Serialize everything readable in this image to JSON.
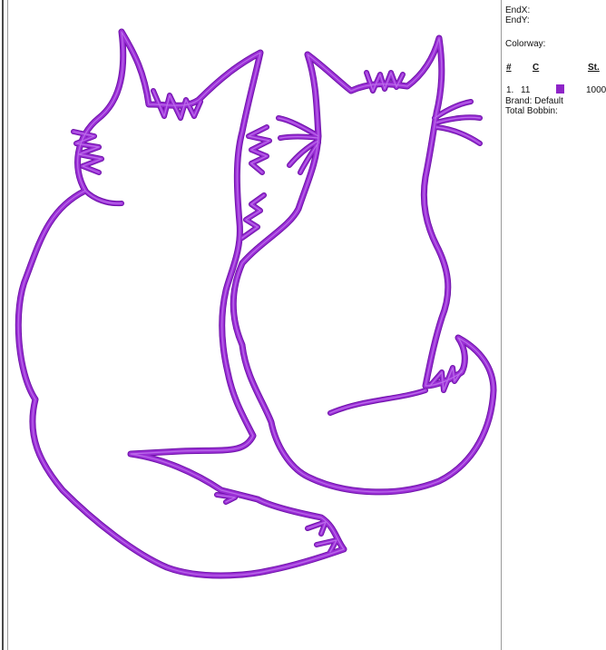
{
  "info_panel": {
    "endx_label": "EndX:",
    "endy_label": "EndY:",
    "colorway_label": "Colorway:",
    "columns": {
      "num": "#",
      "color": "C",
      "stitches": "St."
    },
    "rows": [
      {
        "num": "1.",
        "color_code": "11",
        "swatch_color": "#8e24c8",
        "stitches": "1000"
      }
    ],
    "brand": "Brand: Default",
    "total_bobbin": "Total Bobbin:"
  },
  "design": {
    "thread_color": "#9b2fd6",
    "thread_shadow": "#6d12a8",
    "icon_name": "two-cats-outline-embroidery"
  }
}
